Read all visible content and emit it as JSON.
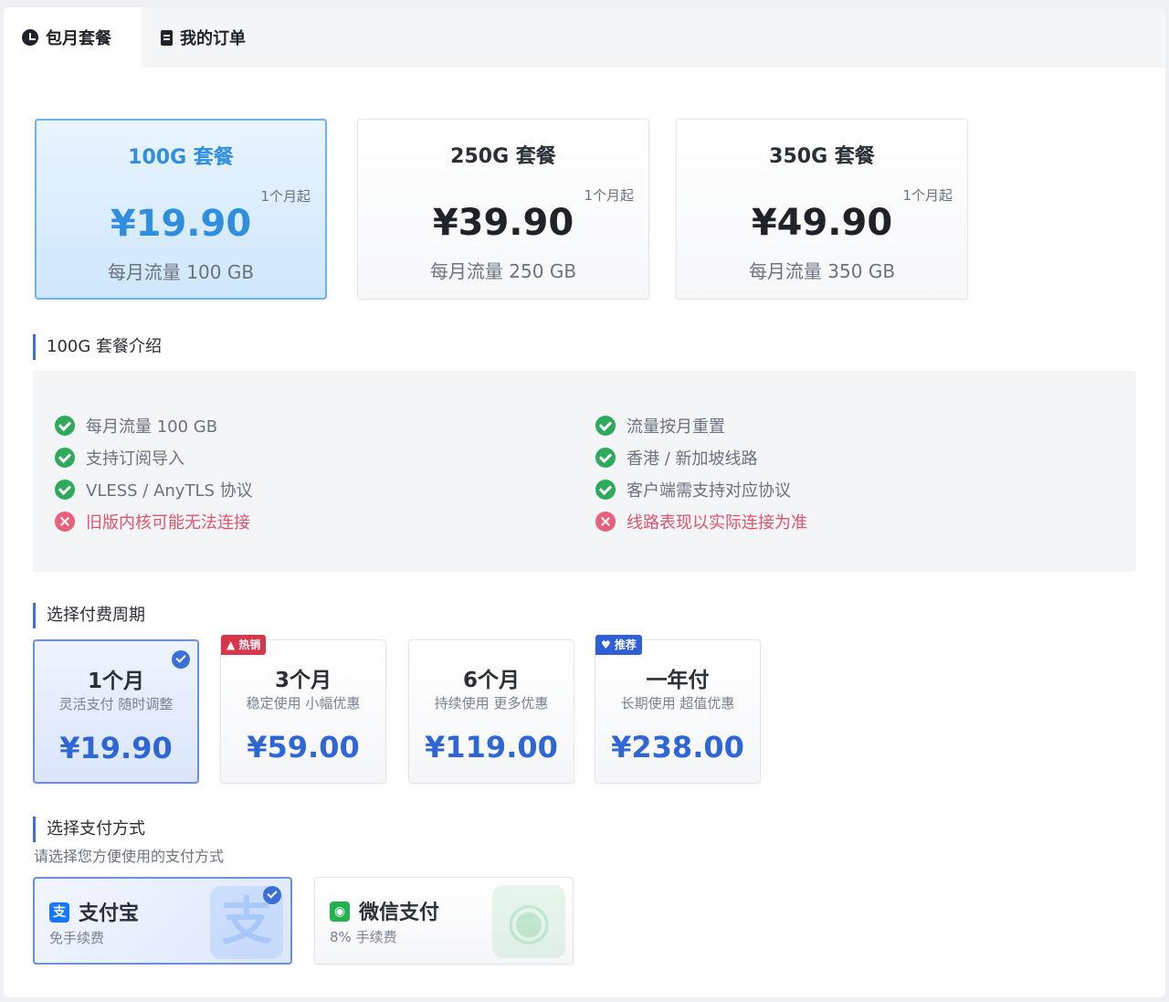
{
  "tabs": [
    {
      "label": "包月套餐",
      "icon": "clock-icon",
      "active": true
    },
    {
      "label": "我的订单",
      "icon": "document-icon",
      "active": false
    }
  ],
  "plans": [
    {
      "name": "100G 套餐",
      "since": "1个月起",
      "price": "¥19.90",
      "traffic": "每月流量 100 GB",
      "selected": true
    },
    {
      "name": "250G 套餐",
      "since": "1个月起",
      "price": "¥39.90",
      "traffic": "每月流量 250 GB",
      "selected": false
    },
    {
      "name": "350G 套餐",
      "since": "1个月起",
      "price": "¥49.90",
      "traffic": "每月流量 350 GB",
      "selected": false
    }
  ],
  "intro": {
    "title": "100G 套餐介绍",
    "left": [
      {
        "text": "每月流量 100 GB",
        "ok": true
      },
      {
        "text": "支持订阅导入",
        "ok": true
      },
      {
        "text": "VLESS / AnyTLS 协议",
        "ok": true
      },
      {
        "text": "旧版内核可能无法连接",
        "ok": false
      }
    ],
    "right": [
      {
        "text": "流量按月重置",
        "ok": true
      },
      {
        "text": "香港 / 新加坡线路",
        "ok": true
      },
      {
        "text": "客户端需支持对应协议",
        "ok": true
      },
      {
        "text": "线路表现以实际连接为准",
        "ok": false
      }
    ]
  },
  "period": {
    "title": "选择付费周期",
    "options": [
      {
        "label": "1个月",
        "desc": "灵活支付 随时调整",
        "price": "¥19.90",
        "badge": "",
        "selected": true
      },
      {
        "label": "3个月",
        "desc": "稳定使用 小幅优惠",
        "price": "¥59.00",
        "badge": "▲ 热销",
        "selected": false
      },
      {
        "label": "6个月",
        "desc": "持续使用 更多优惠",
        "price": "¥119.00",
        "badge": "",
        "selected": false
      },
      {
        "label": "一年付",
        "desc": "长期使用 超值优惠",
        "price": "¥238.00",
        "badge": "♥ 推荐",
        "selected": false
      }
    ]
  },
  "payment": {
    "title": "选择支付方式",
    "subtitle": "请选择您方便使用的支付方式",
    "methods": [
      {
        "name": "支付宝",
        "fee": "免手续费",
        "icon_char": "支",
        "watermark": "支",
        "color": "#1677ff",
        "selected": true
      },
      {
        "name": "微信支付",
        "fee": "8% 手续费",
        "icon_char": "◉",
        "watermark": "◉",
        "color": "#22b14c",
        "selected": false
      }
    ]
  }
}
